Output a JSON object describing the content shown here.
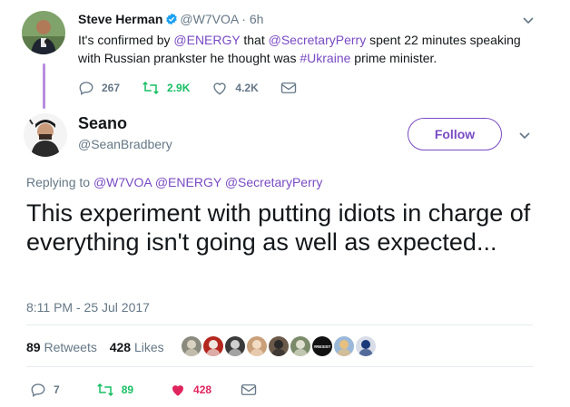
{
  "parent_tweet": {
    "name": "Steve Herman",
    "handle": "@W7VOA",
    "separator": "·",
    "time": "6h",
    "text": [
      {
        "t": "It's confirmed by ",
        "entity": false
      },
      {
        "t": "@ENERGY",
        "entity": true
      },
      {
        "t": " that ",
        "entity": false
      },
      {
        "t": "@SecretaryPerry",
        "entity": true
      },
      {
        "t": " spent 22 minutes speaking with Russian prankster he thought was ",
        "entity": false
      },
      {
        "t": "#Ukraine",
        "entity": true
      },
      {
        "t": " prime minister.",
        "entity": false
      }
    ],
    "replies": "267",
    "retweets": "2.9K",
    "likes": "4.2K"
  },
  "main_tweet": {
    "name": "Seano",
    "handle": "@SeanBradbery",
    "follow_label": "Follow",
    "replying_to_label": "Replying to",
    "replying_to": [
      "@W7VOA",
      "@ENERGY",
      "@SecretaryPerry"
    ],
    "text": "This experiment with putting idiots in charge of everything isn't going as well as expected...",
    "timestamp": "8:11 PM - 25 Jul 2017",
    "retweet_count": "89",
    "retweet_label": "Retweets",
    "like_count": "428",
    "like_label": "Likes",
    "liker_avatars": [
      {
        "bg": "#8a8a7e",
        "fg": "#d9d2c0"
      },
      {
        "bg": "#b3261e",
        "fg": "#f0e6e0"
      },
      {
        "bg": "#3a3a3a",
        "fg": "#cfcfcf"
      },
      {
        "bg": "#c9a07a",
        "fg": "#f3dcc4"
      },
      {
        "bg": "#6b5a4a",
        "fg": "#2b2b2b"
      },
      {
        "bg": "#7a8a6a",
        "fg": "#e0e0d0"
      },
      {
        "bg": "#111111",
        "fg": "#ffffff",
        "label": "#RESIST"
      },
      {
        "bg": "#9ab8d8",
        "fg": "#e8c080"
      },
      {
        "bg": "#d8dde8",
        "fg": "#1b3a7a"
      }
    ],
    "action_replies": "7",
    "action_retweets": "89",
    "action_likes": "428"
  },
  "colors": {
    "accent": "#794bc4",
    "thread_line": "#b88de0",
    "retweet_green": "#17bf63",
    "like_red": "#e0245e",
    "muted": "#657786",
    "verified_blue": "#1da1f2"
  },
  "icons": [
    "verified-badge-icon",
    "chevron-down-icon",
    "reply-icon",
    "retweet-icon",
    "heart-icon",
    "envelope-icon"
  ]
}
